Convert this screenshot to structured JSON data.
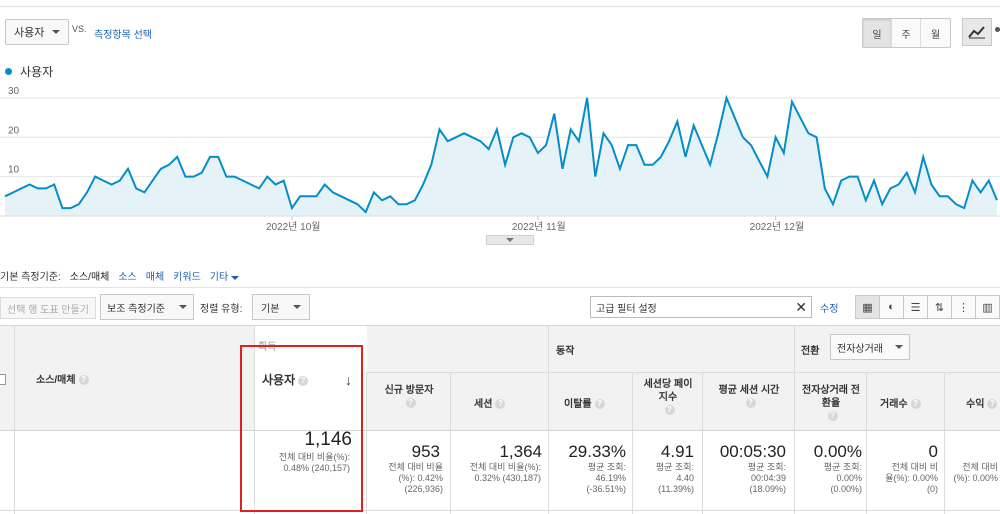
{
  "header": {
    "metric_selector": "사용자",
    "vs_label": "VS.",
    "compare_link": "측정항목 선택",
    "period_buttons": [
      "일",
      "주",
      "월"
    ],
    "active_period": "일"
  },
  "legend": {
    "label": "사용자",
    "color": "#058dc7"
  },
  "chart_data": {
    "type": "area",
    "title": "",
    "series": [
      {
        "name": "사용자",
        "color": "#058dc7",
        "values": [
          5,
          6,
          7,
          8,
          7,
          7,
          8,
          2,
          2,
          3,
          6,
          10,
          9,
          8,
          9,
          12,
          7,
          6,
          9,
          12,
          13,
          15,
          10,
          10,
          11,
          15,
          15,
          10,
          10,
          9,
          8,
          7,
          10,
          8,
          9,
          2,
          5,
          5,
          5,
          8,
          6,
          5,
          4,
          3,
          1,
          6,
          4,
          5,
          3,
          3,
          4,
          8,
          13,
          22,
          19,
          20,
          21,
          20,
          19,
          17,
          22,
          13,
          20,
          21,
          20,
          16,
          18,
          26,
          12,
          22,
          19,
          30,
          10,
          21,
          18,
          12,
          18,
          18,
          13,
          13,
          15,
          19,
          24,
          15,
          23,
          18,
          13,
          21,
          30,
          25,
          20,
          18,
          14,
          10,
          20,
          16,
          29,
          25,
          21,
          20,
          7,
          3,
          9,
          10,
          10,
          4,
          9,
          3,
          7,
          8,
          11,
          6,
          15,
          8,
          5,
          5,
          3,
          2,
          9,
          6,
          9,
          4
        ]
      }
    ],
    "ylim": [
      0,
      32
    ],
    "yticks": [
      "30",
      "20",
      "10"
    ],
    "xticks": [
      "2022년 10월",
      "2022년 11월",
      "2022년 12월"
    ],
    "grid": true
  },
  "dimension_bar": {
    "label": "기본 측정기준:",
    "items": [
      "소스/매체",
      "소스",
      "매체",
      "키워드",
      "기타"
    ]
  },
  "toolbar": {
    "plot_rows": "선택 행 도표 만들기",
    "secondary_dim": "보조 측정기준",
    "sort_type_label": "정렬 유형:",
    "sort_type_value": "기본",
    "filter_value": "고급 필터 설정",
    "edit_label": "수정"
  },
  "table": {
    "dimension_header": "소스/매체",
    "group_acquisition": "획득",
    "group_behavior": "동작",
    "group_conversion": "전환",
    "conversion_select": "전자상거래",
    "columns": [
      {
        "header": "사용자",
        "value": "1,146",
        "sub": [
          "전체 대비 비율(%):",
          "0.48% (240,157)"
        ]
      },
      {
        "header": "신규 방문자",
        "value": "953",
        "sub": [
          "전체 대비 비율",
          "(%): 0.42%",
          "(226,936)"
        ]
      },
      {
        "header": "세션",
        "value": "1,364",
        "sub": [
          "전체 대비 비율(%):",
          "0.32% (430,187)"
        ]
      },
      {
        "header": "이탈률",
        "value": "29.33%",
        "sub": [
          "평균 조회:",
          "46.19%",
          "(-36.51%)"
        ]
      },
      {
        "header": "세션당 페이지수",
        "value": "4.91",
        "sub": [
          "평균 조회:",
          "4.40",
          "(11.39%)"
        ]
      },
      {
        "header": "평균 세션 시간",
        "value": "00:05:30",
        "sub": [
          "평균 조회:",
          "00:04:39",
          "(18.09%)"
        ]
      },
      {
        "header": "전자상거래 전환율",
        "value": "0.00%",
        "sub": [
          "평균 조회:",
          "0.00%",
          "(0.00%)"
        ]
      },
      {
        "header": "거래수",
        "value": "0",
        "sub": [
          "전체 대비 비",
          "율(%): 0.00%",
          "(0)"
        ]
      },
      {
        "header": "수익",
        "value": "",
        "sub": [
          "전체 대비",
          "(%): 0.00%"
        ]
      }
    ]
  }
}
